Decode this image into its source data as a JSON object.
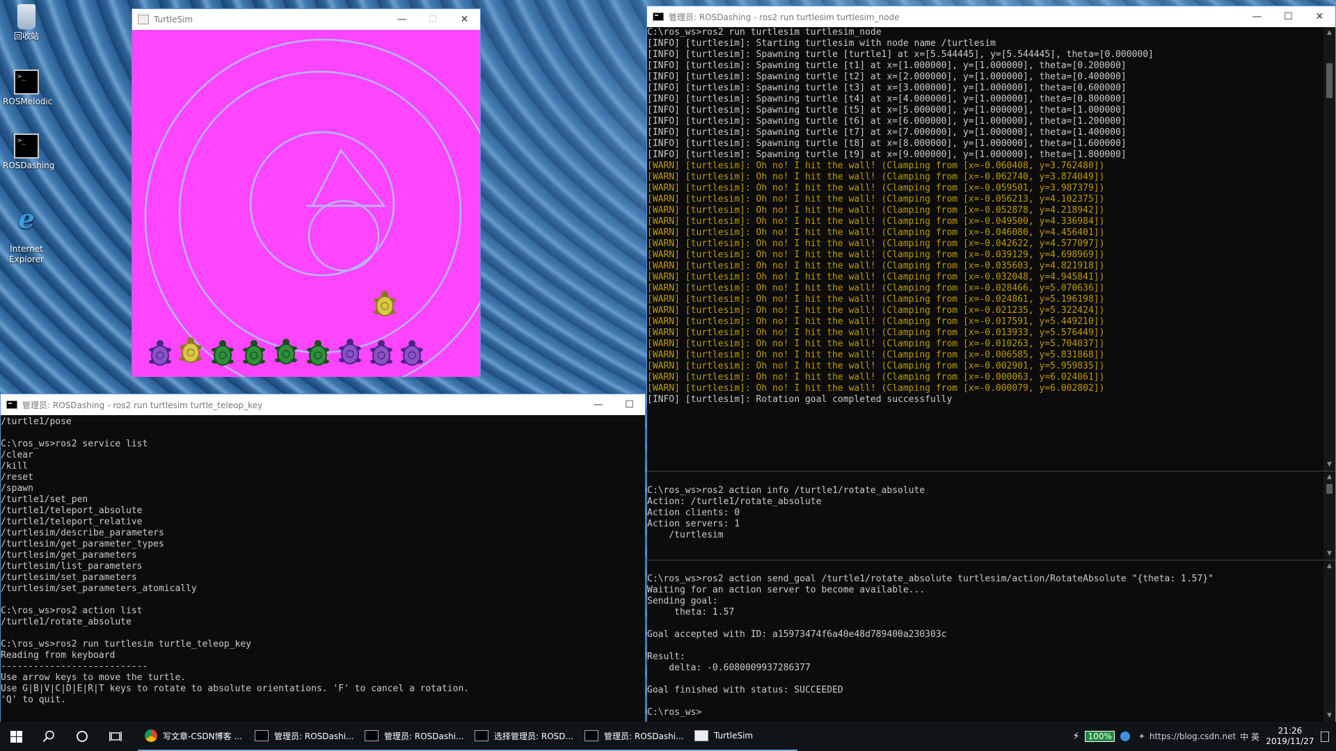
{
  "desktop": {
    "icons": [
      {
        "label": "回收站",
        "icon": "recycle-bin-icon"
      },
      {
        "label": "ROSMelodic",
        "icon": "terminal-shortcut-icon"
      },
      {
        "label": "ROSDashing",
        "icon": "terminal-shortcut-icon"
      },
      {
        "label": "Internet\nExplorer",
        "icon": "internet-explorer-icon"
      }
    ]
  },
  "turtlesim_window": {
    "title": "TurtleSim",
    "background": "#ff45ff",
    "pen_color": "#b3b8ff",
    "turtles": [
      {
        "name": "turtle1",
        "color": "yellow"
      },
      {
        "name": "t1",
        "color": "purple"
      },
      {
        "name": "t2",
        "color": "yellow"
      },
      {
        "name": "t3",
        "color": "green"
      },
      {
        "name": "t4",
        "color": "green"
      },
      {
        "name": "t5",
        "color": "green"
      },
      {
        "name": "t6",
        "color": "green"
      },
      {
        "name": "t7",
        "color": "purple"
      },
      {
        "name": "t8",
        "color": "purple"
      },
      {
        "name": "t9",
        "color": "purple"
      }
    ]
  },
  "node_window": {
    "title": "管理员: ROSDashing - ros2  run turtlesim turtlesim_node",
    "lines": [
      {
        "t": "C:\\ros_ws>ros2 run turtlesim turtlesim_node",
        "k": "n"
      },
      {
        "t": "[INFO] [turtlesim]: Starting turtlesim with node name /turtlesim",
        "k": "n"
      },
      {
        "t": "[INFO] [turtlesim]: Spawning turtle [turtle1] at x=[5.544445], y=[5.544445], theta=[0.000000]",
        "k": "n"
      },
      {
        "t": "[INFO] [turtlesim]: Spawning turtle [t1] at x=[1.000000], y=[1.000000], theta=[0.200000]",
        "k": "n"
      },
      {
        "t": "[INFO] [turtlesim]: Spawning turtle [t2] at x=[2.000000], y=[1.000000], theta=[0.400000]",
        "k": "n"
      },
      {
        "t": "[INFO] [turtlesim]: Spawning turtle [t3] at x=[3.000000], y=[1.000000], theta=[0.600000]",
        "k": "n"
      },
      {
        "t": "[INFO] [turtlesim]: Spawning turtle [t4] at x=[4.000000], y=[1.000000], theta=[0.800000]",
        "k": "n"
      },
      {
        "t": "[INFO] [turtlesim]: Spawning turtle [t5] at x=[5.000000], y=[1.000000], theta=[1.000000]",
        "k": "n"
      },
      {
        "t": "[INFO] [turtlesim]: Spawning turtle [t6] at x=[6.000000], y=[1.000000], theta=[1.200000]",
        "k": "n"
      },
      {
        "t": "[INFO] [turtlesim]: Spawning turtle [t7] at x=[7.000000], y=[1.000000], theta=[1.400000]",
        "k": "n"
      },
      {
        "t": "[INFO] [turtlesim]: Spawning turtle [t8] at x=[8.000000], y=[1.000000], theta=[1.600000]",
        "k": "n"
      },
      {
        "t": "[INFO] [turtlesim]: Spawning turtle [t9] at x=[9.000000], y=[1.000000], theta=[1.800000]",
        "k": "n"
      },
      {
        "t": "[WARN] [turtlesim]: Oh no! I hit the wall! (Clamping from [x=-0.060408, y=3.762480])",
        "k": "w"
      },
      {
        "t": "[WARN] [turtlesim]: Oh no! I hit the wall! (Clamping from [x=-0.062740, y=3.874049])",
        "k": "w"
      },
      {
        "t": "[WARN] [turtlesim]: Oh no! I hit the wall! (Clamping from [x=-0.059501, y=3.987379])",
        "k": "w"
      },
      {
        "t": "[WARN] [turtlesim]: Oh no! I hit the wall! (Clamping from [x=-0.056213, y=4.102375])",
        "k": "w"
      },
      {
        "t": "[WARN] [turtlesim]: Oh no! I hit the wall! (Clamping from [x=-0.052878, y=4.218942])",
        "k": "w"
      },
      {
        "t": "[WARN] [turtlesim]: Oh no! I hit the wall! (Clamping from [x=-0.049500, y=4.336984])",
        "k": "w"
      },
      {
        "t": "[WARN] [turtlesim]: Oh no! I hit the wall! (Clamping from [x=-0.046080, y=4.456401])",
        "k": "w"
      },
      {
        "t": "[WARN] [turtlesim]: Oh no! I hit the wall! (Clamping from [x=-0.042622, y=4.577097])",
        "k": "w"
      },
      {
        "t": "[WARN] [turtlesim]: Oh no! I hit the wall! (Clamping from [x=-0.039129, y=4.698969])",
        "k": "w"
      },
      {
        "t": "[WARN] [turtlesim]: Oh no! I hit the wall! (Clamping from [x=-0.035603, y=4.821918])",
        "k": "w"
      },
      {
        "t": "[WARN] [turtlesim]: Oh no! I hit the wall! (Clamping from [x=-0.032048, y=4.945841])",
        "k": "w"
      },
      {
        "t": "[WARN] [turtlesim]: Oh no! I hit the wall! (Clamping from [x=-0.028466, y=5.070636])",
        "k": "w"
      },
      {
        "t": "[WARN] [turtlesim]: Oh no! I hit the wall! (Clamping from [x=-0.024861, y=5.196198])",
        "k": "w"
      },
      {
        "t": "[WARN] [turtlesim]: Oh no! I hit the wall! (Clamping from [x=-0.021235, y=5.322424])",
        "k": "w"
      },
      {
        "t": "[WARN] [turtlesim]: Oh no! I hit the wall! (Clamping from [x=-0.017591, y=5.449210])",
        "k": "w"
      },
      {
        "t": "[WARN] [turtlesim]: Oh no! I hit the wall! (Clamping from [x=-0.013933, y=5.576449])",
        "k": "w"
      },
      {
        "t": "[WARN] [turtlesim]: Oh no! I hit the wall! (Clamping from [x=-0.010263, y=5.704037])",
        "k": "w"
      },
      {
        "t": "[WARN] [turtlesim]: Oh no! I hit the wall! (Clamping from [x=-0.006585, y=5.831868])",
        "k": "w"
      },
      {
        "t": "[WARN] [turtlesim]: Oh no! I hit the wall! (Clamping from [x=-0.002901, y=5.959835])",
        "k": "w"
      },
      {
        "t": "[WARN] [turtlesim]: Oh no! I hit the wall! (Clamping from [x=-0.000063, y=6.024061])",
        "k": "w"
      },
      {
        "t": "[WARN] [turtlesim]: Oh no! I hit the wall! (Clamping from [x=-0.000079, y=6.002802])",
        "k": "w"
      },
      {
        "t": "[INFO] [turtlesim]: Rotation goal completed successfully",
        "k": "n"
      }
    ],
    "pane2_lines": [
      "C:\\ros_ws>ros2 action info /turtle1/rotate_absolute",
      "Action: /turtle1/rotate_absolute",
      "Action clients: 0",
      "Action servers: 1",
      "    /turtlesim"
    ],
    "pane3_lines": [
      "C:\\ros_ws>ros2 action send_goal /turtle1/rotate_absolute turtlesim/action/RotateAbsolute \"{theta: 1.57}\"",
      "Waiting for an action server to become available...",
      "Sending goal:",
      "     theta: 1.57",
      "",
      "Goal accepted with ID: a15973474f6a40e48d789400a230303c",
      "",
      "Result:",
      "    delta: -0.6080009937286377",
      "",
      "Goal finished with status: SUCCEEDED",
      "",
      "C:\\ros_ws>"
    ]
  },
  "teleop_window": {
    "title": "管理员: ROSDashing - ros2  run turtlesim turtle_teleop_key",
    "lines": [
      "/turtle1/pose",
      "",
      "C:\\ros_ws>ros2 service list",
      "/clear",
      "/kill",
      "/reset",
      "/spawn",
      "/turtle1/set_pen",
      "/turtle1/teleport_absolute",
      "/turtle1/teleport_relative",
      "/turtlesim/describe_parameters",
      "/turtlesim/get_parameter_types",
      "/turtlesim/get_parameters",
      "/turtlesim/list_parameters",
      "/turtlesim/set_parameters",
      "/turtlesim/set_parameters_atomically",
      "",
      "C:\\ros_ws>ros2 action list",
      "/turtle1/rotate_absolute",
      "",
      "C:\\ros_ws>ros2 run turtlesim turtle_teleop_key",
      "Reading from keyboard",
      "---------------------------",
      "Use arrow keys to move the turtle.",
      "Use G|B|V|C|D|E|R|T keys to rotate to absolute orientations. 'F' to cancel a rotation.",
      "'Q' to quit."
    ]
  },
  "taskbar": {
    "apps": [
      {
        "label": "写文章-CSDN博客 ...",
        "icon": "chrome-icon"
      },
      {
        "label": "管理员: ROSDashi...",
        "icon": "terminal-icon"
      },
      {
        "label": "管理员: ROSDashi...",
        "icon": "terminal-icon"
      },
      {
        "label": "选择管理员: ROSD...",
        "icon": "terminal-icon"
      },
      {
        "label": "管理员: ROSDashi...",
        "icon": "terminal-icon"
      },
      {
        "label": "TurtleSim",
        "icon": "turtlesim-icon"
      }
    ],
    "battery": "100%",
    "watermark": "https://blog.csdn.net",
    "tray_text": "中 英",
    "time": "21:26",
    "date": "2019/11/27"
  }
}
